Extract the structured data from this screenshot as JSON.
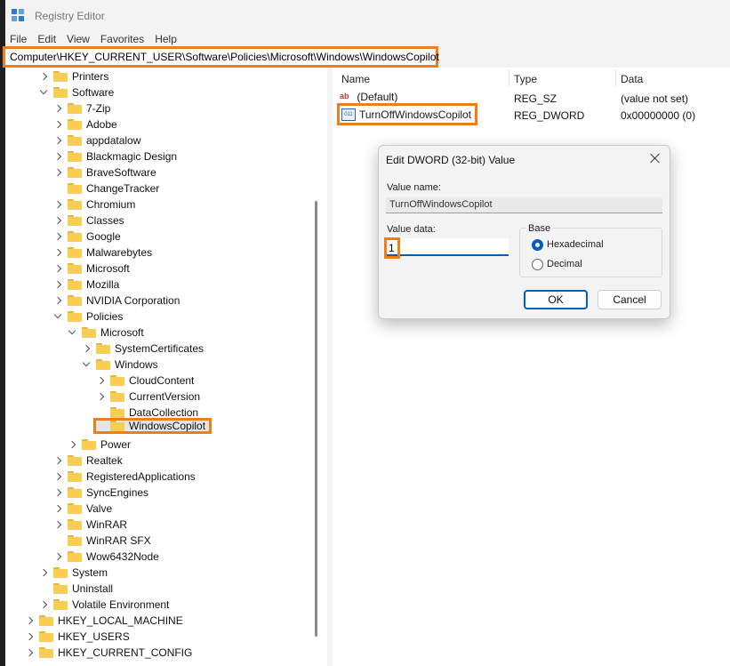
{
  "window": {
    "title": "Registry Editor"
  },
  "menu": [
    "File",
    "Edit",
    "View",
    "Favorites",
    "Help"
  ],
  "address": "Computer\\HKEY_CURRENT_USER\\Software\\Policies\\Microsoft\\Windows\\WindowsCopilot",
  "tree": [
    {
      "label": "Printers",
      "chev": "right"
    },
    {
      "label": "Software",
      "chev": "down"
    },
    {
      "label": "7-Zip",
      "chev": "right"
    },
    {
      "label": "Adobe",
      "chev": "right"
    },
    {
      "label": "appdatalow",
      "chev": "right"
    },
    {
      "label": "Blackmagic Design",
      "chev": "right"
    },
    {
      "label": "BraveSoftware",
      "chev": "right"
    },
    {
      "label": "ChangeTracker",
      "chev": "none"
    },
    {
      "label": "Chromium",
      "chev": "right"
    },
    {
      "label": "Classes",
      "chev": "right"
    },
    {
      "label": "Google",
      "chev": "right"
    },
    {
      "label": "Malwarebytes",
      "chev": "right"
    },
    {
      "label": "Microsoft",
      "chev": "right"
    },
    {
      "label": "Mozilla",
      "chev": "right"
    },
    {
      "label": "NVIDIA Corporation",
      "chev": "right"
    },
    {
      "label": "Policies",
      "chev": "down"
    },
    {
      "label": "Microsoft",
      "chev": "down"
    },
    {
      "label": "SystemCertificates",
      "chev": "right"
    },
    {
      "label": "Windows",
      "chev": "down"
    },
    {
      "label": "CloudContent",
      "chev": "right"
    },
    {
      "label": "CurrentVersion",
      "chev": "right"
    },
    {
      "label": "DataCollection",
      "chev": "none"
    },
    {
      "label": "WindowsCopilot",
      "chev": "none",
      "selected": true
    },
    {
      "label": "Power",
      "chev": "right"
    },
    {
      "label": "Realtek",
      "chev": "right"
    },
    {
      "label": "RegisteredApplications",
      "chev": "right"
    },
    {
      "label": "SyncEngines",
      "chev": "right"
    },
    {
      "label": "Valve",
      "chev": "right"
    },
    {
      "label": "WinRAR",
      "chev": "right"
    },
    {
      "label": "WinRAR SFX",
      "chev": "none"
    },
    {
      "label": "Wow6432Node",
      "chev": "right"
    },
    {
      "label": "System",
      "chev": "right"
    },
    {
      "label": "Uninstall",
      "chev": "none"
    },
    {
      "label": "Volatile Environment",
      "chev": "right"
    },
    {
      "label": "HKEY_LOCAL_MACHINE",
      "chev": "right"
    },
    {
      "label": "HKEY_USERS",
      "chev": "right"
    },
    {
      "label": "HKEY_CURRENT_CONFIG",
      "chev": "right"
    }
  ],
  "values": {
    "headers": {
      "name": "Name",
      "type": "Type",
      "data": "Data"
    },
    "rows": [
      {
        "name": "(Default)",
        "type": "REG_SZ",
        "data": "(value not set)",
        "icon": "string-value-icon"
      },
      {
        "name": "TurnOffWindowsCopilot",
        "type": "REG_DWORD",
        "data": "0x00000000 (0)",
        "icon": "dword-value-icon"
      }
    ]
  },
  "dialog": {
    "title": "Edit DWORD (32-bit) Value",
    "value_name_label": "Value name:",
    "value_name": "TurnOffWindowsCopilot",
    "value_data_label": "Value data:",
    "value_data": "1",
    "base_label": "Base",
    "radios": [
      {
        "label": "Hexadecimal",
        "checked": true
      },
      {
        "label": "Decimal",
        "checked": false
      }
    ],
    "ok_label": "OK",
    "cancel_label": "Cancel"
  }
}
